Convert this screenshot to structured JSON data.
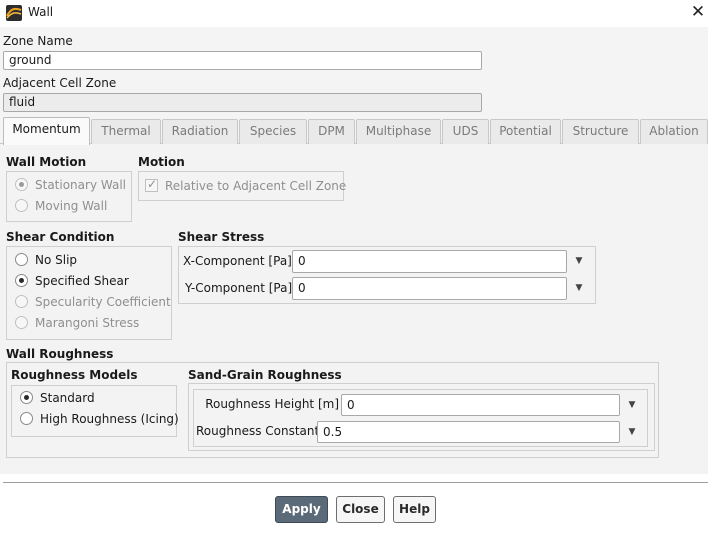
{
  "window": {
    "title": "Wall",
    "icon": "fluent-app-icon",
    "close_icon": "close-icon"
  },
  "zone": {
    "name_label": "Zone Name",
    "name_value": "ground",
    "adjacent_label": "Adjacent Cell Zone",
    "adjacent_value": "fluid"
  },
  "tabs": [
    {
      "label": "Momentum",
      "active": true
    },
    {
      "label": "Thermal"
    },
    {
      "label": "Radiation"
    },
    {
      "label": "Species"
    },
    {
      "label": "DPM"
    },
    {
      "label": "Multiphase"
    },
    {
      "label": "UDS"
    },
    {
      "label": "Potential"
    },
    {
      "label": "Structure"
    },
    {
      "label": "Ablation"
    }
  ],
  "wall_motion": {
    "title": "Wall Motion",
    "options": [
      "Stationary Wall",
      "Moving Wall"
    ],
    "selected": "Stationary Wall"
  },
  "motion": {
    "title": "Motion",
    "relative_label": "Relative to Adjacent Cell Zone",
    "relative_checked": true
  },
  "shear_condition": {
    "title": "Shear Condition",
    "options": [
      "No Slip",
      "Specified Shear",
      "Specularity Coefficient",
      "Marangoni Stress"
    ],
    "selected": "Specified Shear"
  },
  "shear_stress": {
    "title": "Shear Stress",
    "x_label": "X-Component [Pa]",
    "x_value": "0",
    "y_label": "Y-Component [Pa]",
    "y_value": "0"
  },
  "wall_roughness": {
    "title": "Wall Roughness",
    "models_title": "Roughness Models",
    "models": [
      "Standard",
      "High Roughness (Icing)"
    ],
    "selected_model": "Standard",
    "sand_grain_title": "Sand-Grain Roughness",
    "height_label": "Roughness Height [m]",
    "height_value": "0",
    "constant_label": "Roughness Constant",
    "constant_value": "0.5"
  },
  "buttons": {
    "apply": "Apply",
    "close": "Close",
    "help": "Help"
  }
}
